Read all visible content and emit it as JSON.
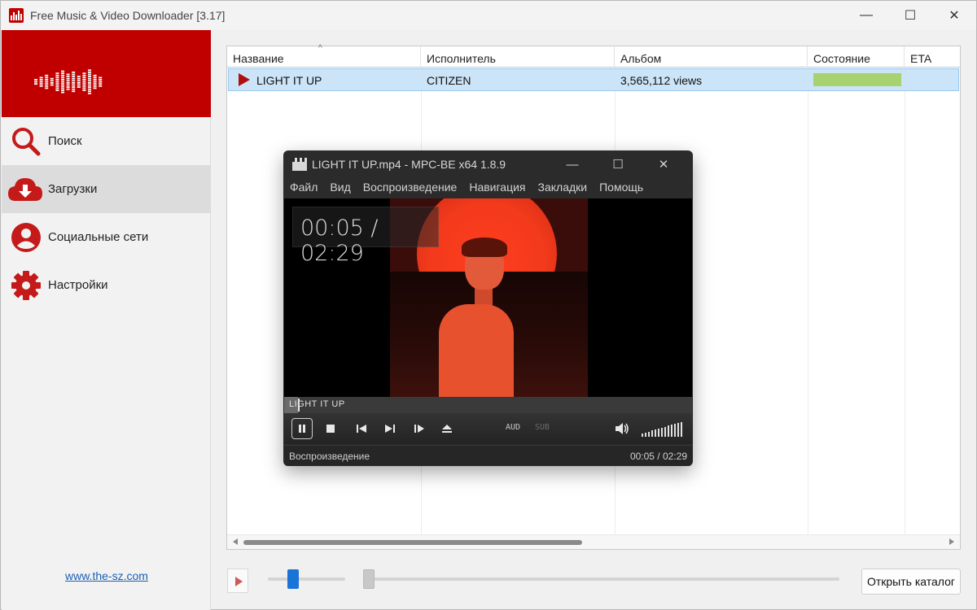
{
  "window": {
    "title": "Free Music & Video Downloader [3.17]",
    "minimize_glyph": "—",
    "maximize_glyph": "☐",
    "close_glyph": "✕"
  },
  "sidebar": {
    "items": [
      {
        "label": "Поиск",
        "icon": "search-icon"
      },
      {
        "label": "Загрузки",
        "icon": "download-cloud-icon"
      },
      {
        "label": "Социальные сети",
        "icon": "user-icon"
      },
      {
        "label": "Настройки",
        "icon": "gear-icon"
      }
    ],
    "active_index": 1,
    "link": "www.the-sz.com"
  },
  "table": {
    "columns": [
      "Название",
      "Исполнитель",
      "Альбом",
      "Состояние",
      "ETA"
    ],
    "sort_glyph": "^",
    "rows": [
      {
        "title": "LIGHT IT UP",
        "artist": "CITIZEN",
        "album": "3,565,112 views",
        "progress": 1.0,
        "eta": ""
      }
    ]
  },
  "bottom": {
    "open_folder_label": "Открыть каталог",
    "volume_level": 0.3,
    "seek_position": 0.0
  },
  "player": {
    "title": "LIGHT IT UP.mp4 - MPC-BE x64 1.8.9",
    "menu": [
      "Файл",
      "Вид",
      "Воспроизведение",
      "Навигация",
      "Закладки",
      "Помощь"
    ],
    "osd_time": "00:05 / 02:29",
    "seek_label": "LIGHT IT UP",
    "seek_fraction": 0.034,
    "aud_label": "AUD",
    "sub_label": "SUB",
    "status_text": "Воспроизведение",
    "status_time": "00:05 / 02:29",
    "accent_sun": "#f33a1c"
  },
  "colors": {
    "brand_red": "#c00000",
    "selection": "#cce4f7",
    "progress_green": "#a8d16f",
    "volume_blue": "#1a74d8",
    "link_blue": "#1a5fb4"
  }
}
